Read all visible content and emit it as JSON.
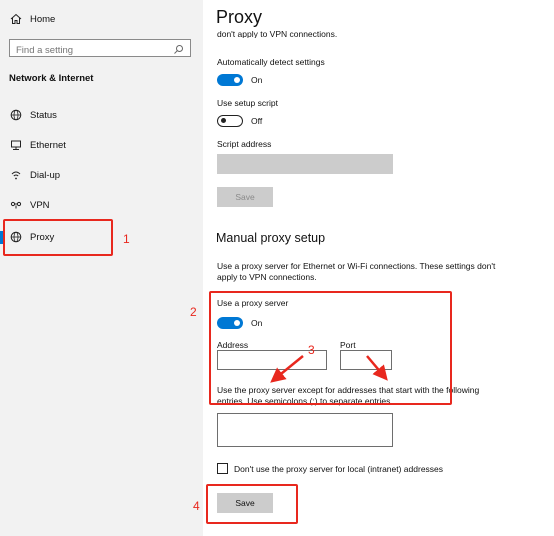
{
  "sidebar": {
    "home_label": "Home",
    "search": {
      "placeholder": "Find a setting"
    },
    "section_title": "Network & Internet",
    "items": [
      {
        "label": "Status",
        "icon": "globe-status-icon"
      },
      {
        "label": "Ethernet",
        "icon": "ethernet-icon"
      },
      {
        "label": "Dial-up",
        "icon": "dialup-icon"
      },
      {
        "label": "VPN",
        "icon": "vpn-icon"
      },
      {
        "label": "Proxy",
        "icon": "globe-icon",
        "selected": true
      }
    ]
  },
  "main": {
    "title": "Proxy",
    "cut_text": "don't apply to VPN connections.",
    "auto": {
      "detect_label": "Automatically detect settings",
      "detect_state": "On",
      "script_label": "Use setup script",
      "script_state": "Off",
      "address_label": "Script address",
      "save_label": "Save"
    },
    "manual": {
      "heading": "Manual proxy setup",
      "description": "Use a proxy server for Ethernet or Wi-Fi connections. These settings don't apply to VPN connections.",
      "use_proxy_label": "Use a proxy server",
      "use_proxy_state": "On",
      "address_label": "Address",
      "port_label": "Port",
      "exceptions_text": "Use the proxy server except for addresses that start with the following entries. Use semicolons (;) to separate entries.",
      "local_checkbox_label": "Don't use the proxy server for local (intranet) addresses",
      "save_label": "Save"
    }
  },
  "annotations": {
    "n1": "1",
    "n2": "2",
    "n3": "3",
    "n4": "4"
  },
  "colors": {
    "accent": "#0078d4",
    "annotation": "#e8281e",
    "sidebar_bg": "#f2f2f2"
  }
}
